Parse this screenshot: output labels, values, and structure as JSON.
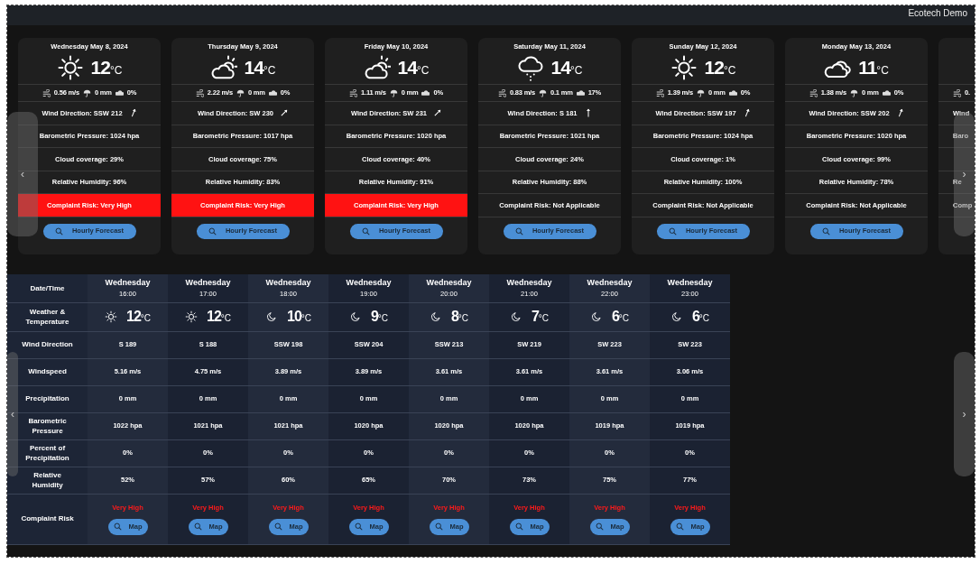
{
  "header": {
    "title": "Ecotech Demo"
  },
  "day_nav": {
    "prev": "‹",
    "next": "›"
  },
  "days": [
    {
      "kind": "sun",
      "date": "Wednesday May 8, 2024",
      "temp": "12",
      "unit": "°C",
      "wind_speed": "0.56 m/s",
      "precipitation": "0 mm",
      "precip_chance": "0%",
      "wind_direction": "Wind Direction: SSW 212",
      "arrow": {
        "kind": "ssw"
      },
      "pressure": "Barometric Pressure: 1024 hpa",
      "cloud": "Cloud coverage: 29%",
      "humidity": "Relative Humidity: 96%",
      "risk": "Complaint Risk: Very High",
      "alert": true,
      "button": "Hourly Forecast"
    },
    {
      "kind": "partly-cloudy",
      "date": "Thursday May 9, 2024",
      "temp": "14",
      "unit": "°C",
      "wind_speed": "2.22 m/s",
      "precipitation": "0 mm",
      "precip_chance": "0%",
      "wind_direction": "Wind Direction: SW 230",
      "arrow": {
        "kind": "sw"
      },
      "pressure": "Barometric Pressure: 1017 hpa",
      "cloud": "Cloud coverage: 75%",
      "humidity": "Relative Humidity: 83%",
      "risk": "Complaint Risk: Very High",
      "alert": true,
      "button": "Hourly Forecast"
    },
    {
      "kind": "partly-cloudy",
      "date": "Friday May 10, 2024",
      "temp": "14",
      "unit": "°C",
      "wind_speed": "1.11 m/s",
      "precipitation": "0 mm",
      "precip_chance": "0%",
      "wind_direction": "Wind Direction: SW 231",
      "arrow": {
        "kind": "sw"
      },
      "pressure": "Barometric Pressure: 1020 hpa",
      "cloud": "Cloud coverage: 40%",
      "humidity": "Relative Humidity: 91%",
      "risk": "Complaint Risk: Very High",
      "alert": true,
      "button": "Hourly Forecast"
    },
    {
      "kind": "rain",
      "date": "Saturday May 11, 2024",
      "temp": "14",
      "unit": "°C",
      "wind_speed": "0.83 m/s",
      "precipitation": "0.1 mm",
      "precip_chance": "17%",
      "wind_direction": "Wind Direction: S 181",
      "arrow": {
        "kind": "s"
      },
      "pressure": "Barometric Pressure: 1021 hpa",
      "cloud": "Cloud coverage: 24%",
      "humidity": "Relative Humidity: 88%",
      "risk": "Complaint Risk: Not Applicable",
      "alert": false,
      "button": "Hourly Forecast"
    },
    {
      "kind": "sun",
      "date": "Sunday May 12, 2024",
      "temp": "12",
      "unit": "°C",
      "wind_speed": "1.39 m/s",
      "precipitation": "0 mm",
      "precip_chance": "0%",
      "wind_direction": "Wind Direction: SSW 197",
      "arrow": {
        "kind": "ssw"
      },
      "pressure": "Barometric Pressure: 1024 hpa",
      "cloud": "Cloud coverage: 1%",
      "humidity": "Relative Humidity: 100%",
      "risk": "Complaint Risk: Not Applicable",
      "alert": false,
      "button": "Hourly Forecast"
    },
    {
      "kind": "cloudy",
      "date": "Monday May 13, 2024",
      "temp": "11",
      "unit": "°C",
      "wind_speed": "1.38 m/s",
      "precipitation": "0 mm",
      "precip_chance": "0%",
      "wind_direction": "Wind Direction: SSW 202",
      "arrow": {
        "kind": "ssw"
      },
      "pressure": "Barometric Pressure: 1020 hpa",
      "cloud": "Cloud coverage: 99%",
      "humidity": "Relative Humidity: 78%",
      "risk": "Complaint Risk: Not Applicable",
      "alert": false,
      "button": "Hourly Forecast"
    }
  ],
  "partial_card": {
    "wind_speed": "0.",
    "wind_direction": "Wind",
    "pressure": "Baro",
    "humidity": "Re",
    "risk": "Comp"
  },
  "hourly_nav": {
    "prev": "‹",
    "next": "›"
  },
  "hourly": {
    "row_labels": [
      "Date/Time",
      "Weather & Temperature",
      "Wind Direction",
      "Windspeed",
      "Precipitation",
      "Barometric Pressure",
      "Percent of Precipitation",
      "Relative Humidity",
      "Complaint Risk"
    ],
    "hours": [
      {
        "kind": "sun",
        "day": "Wednesday",
        "time": "16:00",
        "temp": "12",
        "unit": "°C",
        "wind_direction": "S 189",
        "wind_speed": "5.16 m/s",
        "precipitation": "0 mm",
        "pressure": "1022 hpa",
        "precip_chance": "0%",
        "humidity": "52%",
        "risk": "Very High",
        "alert": true,
        "button": "Map"
      },
      {
        "kind": "sun",
        "day": "Wednesday",
        "time": "17:00",
        "temp": "12",
        "unit": "°C",
        "wind_direction": "S 188",
        "wind_speed": "4.75 m/s",
        "precipitation": "0 mm",
        "pressure": "1021 hpa",
        "precip_chance": "0%",
        "humidity": "57%",
        "risk": "Very High",
        "alert": true,
        "button": "Map"
      },
      {
        "kind": "moon",
        "day": "Wednesday",
        "time": "18:00",
        "temp": "10",
        "unit": "°C",
        "wind_direction": "SSW 198",
        "wind_speed": "3.89 m/s",
        "precipitation": "0 mm",
        "pressure": "1021 hpa",
        "precip_chance": "0%",
        "humidity": "60%",
        "risk": "Very High",
        "alert": true,
        "button": "Map"
      },
      {
        "kind": "moon",
        "day": "Wednesday",
        "time": "19:00",
        "temp": "9",
        "unit": "°C",
        "wind_direction": "SSW 204",
        "wind_speed": "3.89 m/s",
        "precipitation": "0 mm",
        "pressure": "1020 hpa",
        "precip_chance": "0%",
        "humidity": "65%",
        "risk": "Very High",
        "alert": true,
        "button": "Map"
      },
      {
        "kind": "moon",
        "day": "Wednesday",
        "time": "20:00",
        "temp": "8",
        "unit": "°C",
        "wind_direction": "SSW 213",
        "wind_speed": "3.61 m/s",
        "precipitation": "0 mm",
        "pressure": "1020 hpa",
        "precip_chance": "0%",
        "humidity": "70%",
        "risk": "Very High",
        "alert": true,
        "button": "Map"
      },
      {
        "kind": "moon",
        "day": "Wednesday",
        "time": "21:00",
        "temp": "7",
        "unit": "°C",
        "wind_direction": "SW 219",
        "wind_speed": "3.61 m/s",
        "precipitation": "0 mm",
        "pressure": "1020 hpa",
        "precip_chance": "0%",
        "humidity": "73%",
        "risk": "Very High",
        "alert": true,
        "button": "Map"
      },
      {
        "kind": "moon",
        "day": "Wednesday",
        "time": "22:00",
        "temp": "6",
        "unit": "°C",
        "wind_direction": "SW 223",
        "wind_speed": "3.61 m/s",
        "precipitation": "0 mm",
        "pressure": "1019 hpa",
        "precip_chance": "0%",
        "humidity": "75%",
        "risk": "Very High",
        "alert": true,
        "button": "Map"
      },
      {
        "kind": "moon",
        "day": "Wednesday",
        "time": "23:00",
        "temp": "6",
        "unit": "°C",
        "wind_direction": "SW 223",
        "wind_speed": "3.06 m/s",
        "precipitation": "0 mm",
        "pressure": "1019 hpa",
        "precip_chance": "0%",
        "humidity": "77%",
        "risk": "Very High",
        "alert": true,
        "button": "Map"
      }
    ]
  }
}
